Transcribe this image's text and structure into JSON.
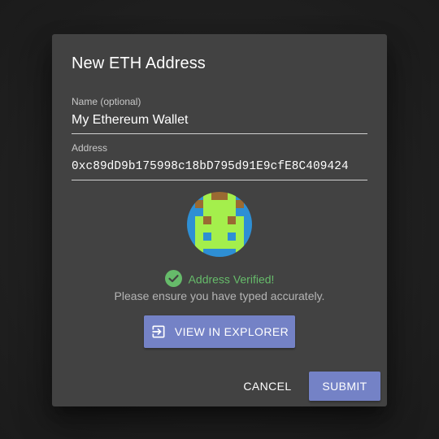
{
  "dialog": {
    "title": "New ETH Address"
  },
  "name_field": {
    "label": "Name (optional)",
    "value": "My Ethereum Wallet"
  },
  "address_field": {
    "label": "Address",
    "value": "0xc89dD9b175998c18bD795d91E9cfE8C409424"
  },
  "identicon": {
    "colors": {
      "background": "#2e8fd4",
      "primary": "#a4ef4c",
      "accent": "#9a6a32"
    }
  },
  "verification": {
    "status": "Address Verified!",
    "hint": "Please ensure you have typed accurately.",
    "icon": "check-circle-icon",
    "color": "#66bb6a"
  },
  "explorer_button": {
    "label": "VIEW IN EXPLORER",
    "icon": "exit-to-app-icon"
  },
  "actions": {
    "cancel_label": "CANCEL",
    "submit_label": "SUBMIT"
  },
  "theme": {
    "accent": "#7482c6",
    "surface": "#424242"
  }
}
